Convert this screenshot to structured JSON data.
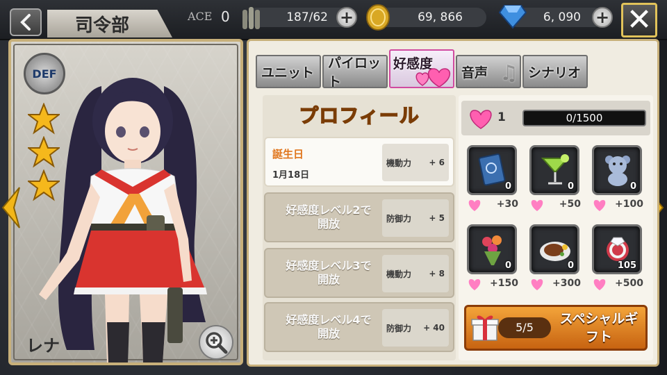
{
  "header": {
    "back_icon": "chevron-left-icon",
    "title": "司令部",
    "ace_label": "ACE",
    "ace_value": "0",
    "ammo": "187/62",
    "coins": "69, 866",
    "gems": "6, 090",
    "plus": "+",
    "close": "✕"
  },
  "character": {
    "class_badge": "DEF",
    "stars": 3,
    "name": "レナ"
  },
  "tabs": [
    {
      "label": "ユニット",
      "active": false
    },
    {
      "label": "パイロット",
      "active": false
    },
    {
      "label": "好感度",
      "active": true
    },
    {
      "label": "音声",
      "active": false
    },
    {
      "label": "シナリオ",
      "active": false
    }
  ],
  "profile": {
    "title": "プロフィール",
    "birthday_label": "誕生日",
    "birthday_date": "1月18日",
    "rows": [
      {
        "line1": "",
        "line2": "",
        "stat": "機動力",
        "bonus": "+ 6"
      },
      {
        "line1": "好感度レベル2で",
        "line2": "開放",
        "stat": "防御力",
        "bonus": "+ 5"
      },
      {
        "line1": "好感度レベル3で",
        "line2": "開放",
        "stat": "機動力",
        "bonus": "+ 8"
      },
      {
        "line1": "好感度レベル4で",
        "line2": "開放",
        "stat": "防御力",
        "bonus": "+ 40"
      }
    ]
  },
  "affection": {
    "level": "1",
    "progress": "0/1500",
    "progress_fraction": 0.0
  },
  "gifts": [
    {
      "name": "book",
      "qty": "0",
      "points": "+30"
    },
    {
      "name": "cocktail",
      "qty": "0",
      "points": "+50"
    },
    {
      "name": "teddy-bear",
      "qty": "0",
      "points": "+100"
    },
    {
      "name": "bouquet",
      "qty": "0",
      "points": "+150"
    },
    {
      "name": "steak",
      "qty": "0",
      "points": "+300"
    },
    {
      "name": "ring",
      "qty": "105",
      "points": "+500"
    }
  ],
  "special_gift": {
    "count": "5/5",
    "label_line1": "スペシャルギ",
    "label_line2": "フト"
  },
  "colors": {
    "gold_border": "#c8b07a",
    "heart_pink": "#ff5fb0",
    "special_orange": "#e0801f"
  }
}
